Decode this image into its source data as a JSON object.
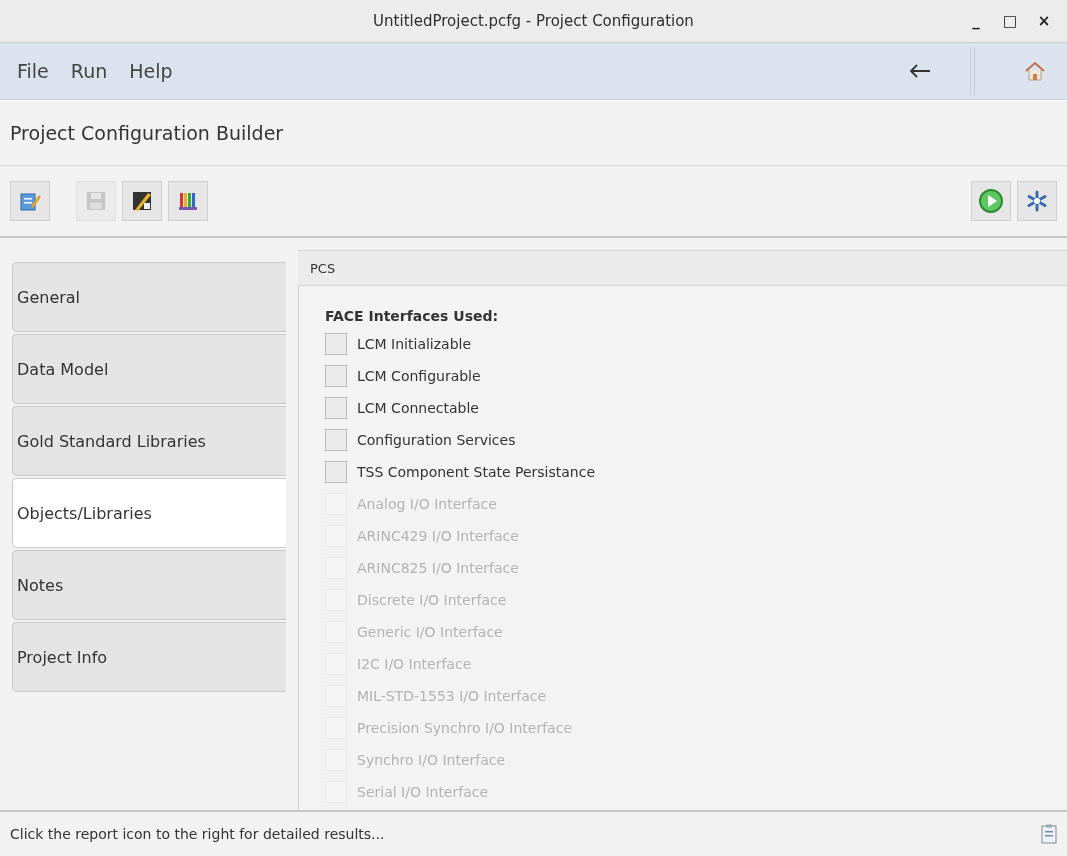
{
  "window": {
    "title": "UntitledProject.pcfg - Project Configuration",
    "controls": [
      "_",
      "□",
      "×"
    ]
  },
  "menu": [
    "File",
    "Run",
    "Help"
  ],
  "header": "Project Configuration Builder",
  "toolbar": {
    "left": [
      {
        "kind": "edit",
        "disabled": false
      },
      {
        "kind": "save",
        "disabled": true
      },
      {
        "kind": "chart",
        "disabled": false
      },
      {
        "kind": "bars",
        "disabled": false
      }
    ],
    "right": [
      {
        "kind": "play",
        "disabled": false
      },
      {
        "kind": "gear",
        "disabled": false
      }
    ]
  },
  "tabs": [
    {
      "label": "General",
      "selected": false
    },
    {
      "label": "Data Model",
      "selected": false
    },
    {
      "label": "Gold Standard Libraries",
      "selected": false
    },
    {
      "label": "Objects/Libraries",
      "selected": true
    },
    {
      "label": "Notes",
      "selected": false
    },
    {
      "label": "Project Info",
      "selected": false
    }
  ],
  "panel": {
    "title": "PCS",
    "section": "FACE Interfaces Used:",
    "items": [
      {
        "label": "LCM Initializable",
        "checked": false,
        "disabled": false
      },
      {
        "label": "LCM Configurable",
        "checked": false,
        "disabled": false
      },
      {
        "label": "LCM Connectable",
        "checked": false,
        "disabled": false
      },
      {
        "label": "Configuration Services",
        "checked": false,
        "disabled": false
      },
      {
        "label": "TSS Component State Persistance",
        "checked": false,
        "disabled": false
      },
      {
        "label": "Analog I/O Interface",
        "checked": false,
        "disabled": true
      },
      {
        "label": "ARINC429 I/O Interface",
        "checked": false,
        "disabled": true
      },
      {
        "label": "ARINC825 I/O Interface",
        "checked": false,
        "disabled": true
      },
      {
        "label": "Discrete I/O Interface",
        "checked": false,
        "disabled": true
      },
      {
        "label": "Generic I/O Interface",
        "checked": false,
        "disabled": true
      },
      {
        "label": "I2C I/O Interface",
        "checked": false,
        "disabled": true
      },
      {
        "label": "MIL-STD-1553 I/O Interface",
        "checked": false,
        "disabled": true
      },
      {
        "label": "Precision Synchro I/O Interface",
        "checked": false,
        "disabled": true
      },
      {
        "label": "Synchro I/O Interface",
        "checked": false,
        "disabled": true
      },
      {
        "label": "Serial I/O Interface",
        "checked": false,
        "disabled": true
      }
    ]
  },
  "status_bar": "Click the report icon to the right for detailed results..."
}
